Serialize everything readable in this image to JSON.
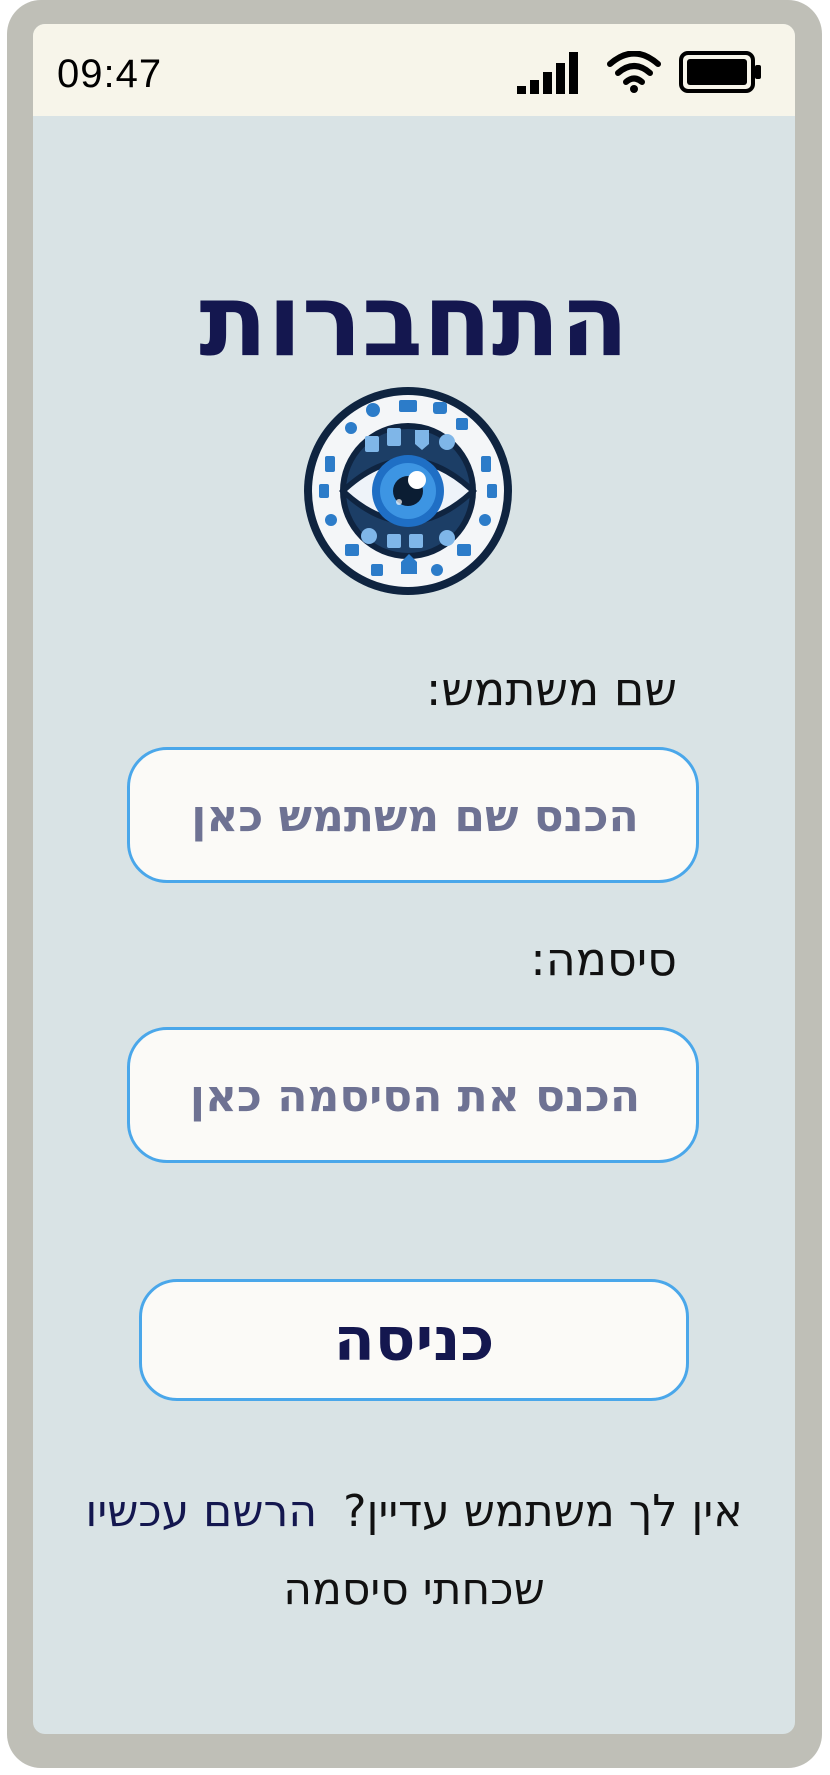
{
  "status_bar": {
    "time": "09:47",
    "icons": [
      "signal-icon",
      "wifi-icon",
      "battery-icon"
    ]
  },
  "page": {
    "title": "התחברות",
    "logo": "eye-logo-icon"
  },
  "form": {
    "username_label": "שם משתמש:",
    "username_placeholder": "הכנס שם משתמש כאן",
    "password_label": "סיסמה:",
    "password_placeholder": "הכנס את הסיסמה כאן",
    "login_button": "כניסה"
  },
  "footer": {
    "no_account_text": "אין לך משתמש עדיין?",
    "signup_link": "הרשם עכשיו",
    "forgot_password": "שכחתי סיסמה"
  },
  "colors": {
    "title": "#14174f",
    "field_border": "#4aa7ea",
    "screen_bg": "#d9e3e5",
    "status_bar_bg": "#f7f5ea",
    "frame": "#bfbfb7"
  }
}
